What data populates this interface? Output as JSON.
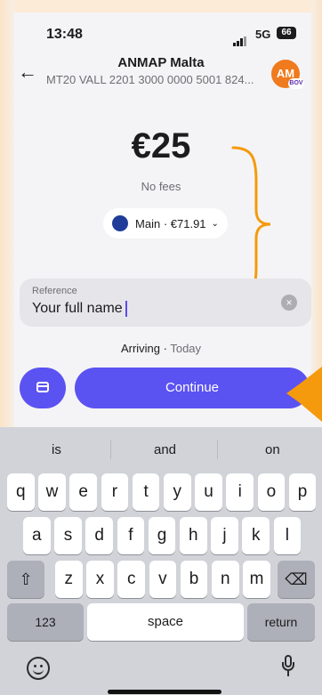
{
  "status": {
    "time": "13:48",
    "network": "5G",
    "battery": "66"
  },
  "header": {
    "title": "ANMAP Malta",
    "subtitle": "MT20 VALL 2201 3000 0000 5001 824...",
    "avatar_initials": "AM",
    "avatar_badge": "BOV"
  },
  "amount": {
    "value": "€25",
    "fees": "No fees"
  },
  "account": {
    "label": "Main · €71.91"
  },
  "reference": {
    "label": "Reference",
    "value": "Your full name"
  },
  "arriving": {
    "prefix": "Arriving · ",
    "when": "Today"
  },
  "actions": {
    "continue": "Continue"
  },
  "keyboard": {
    "suggestions": [
      "is",
      "and",
      "on"
    ],
    "row1": [
      "q",
      "w",
      "e",
      "r",
      "t",
      "y",
      "u",
      "i",
      "o",
      "p"
    ],
    "row2": [
      "a",
      "s",
      "d",
      "f",
      "g",
      "h",
      "j",
      "k",
      "l"
    ],
    "row3": [
      "z",
      "x",
      "c",
      "v",
      "b",
      "n",
      "m"
    ],
    "numbers": "123",
    "space": "space",
    "return": "return"
  },
  "colors": {
    "accent": "#5b52f2",
    "annotation": "#f59a0c"
  }
}
